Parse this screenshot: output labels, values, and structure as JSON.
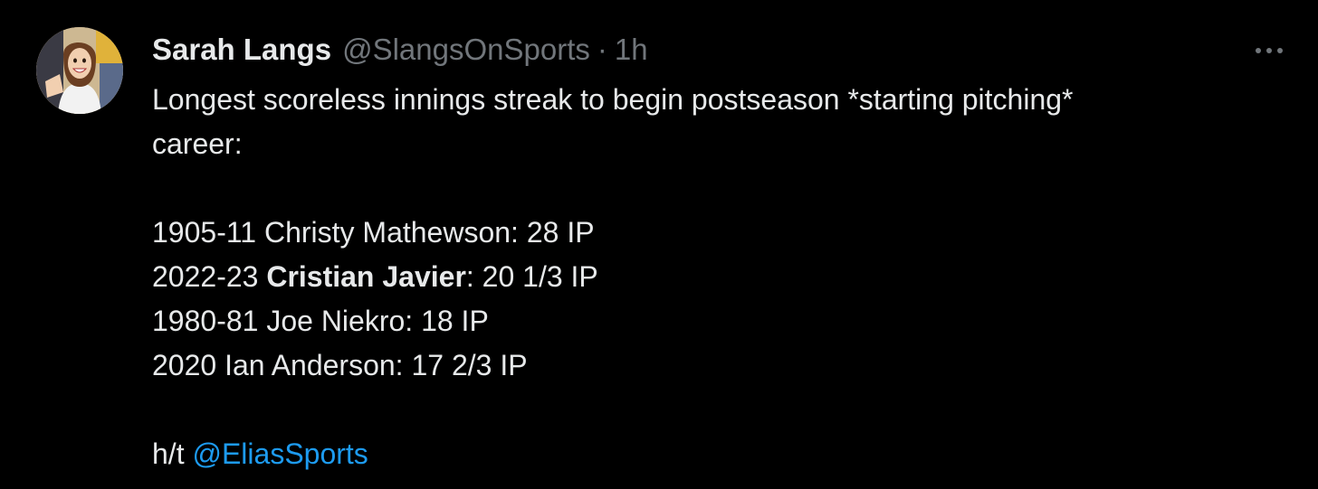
{
  "tweet": {
    "author": {
      "display_name": "Sarah Langs",
      "handle": "@SlangsOnSports",
      "separator": "·",
      "time": "1h",
      "avatar_icon": "user-avatar"
    },
    "more_icon": "more-dots-icon",
    "text": {
      "line1": "Longest scoreless innings streak to begin postseason *starting pitching*",
      "line2": "career:",
      "list": [
        {
          "prefix": "1905-11 ",
          "name": "Christy Mathewson",
          "suffix": ": 28 IP"
        },
        {
          "prefix": "2022-23 ",
          "name": "Cristian Javier",
          "suffix": ": 20 1/3 IP"
        },
        {
          "prefix": "1980-81 ",
          "name": "Joe Niekro",
          "suffix": ": 18 IP"
        },
        {
          "prefix": "2020 ",
          "name": "Ian Anderson",
          "suffix": ": 17 2/3 IP"
        }
      ],
      "ht_prefix": "h/t ",
      "ht_mention": "@EliasSports"
    }
  },
  "colors": {
    "background": "#000000",
    "text": "#e7e9ea",
    "secondary": "#71767b",
    "link": "#1d9bf0"
  }
}
